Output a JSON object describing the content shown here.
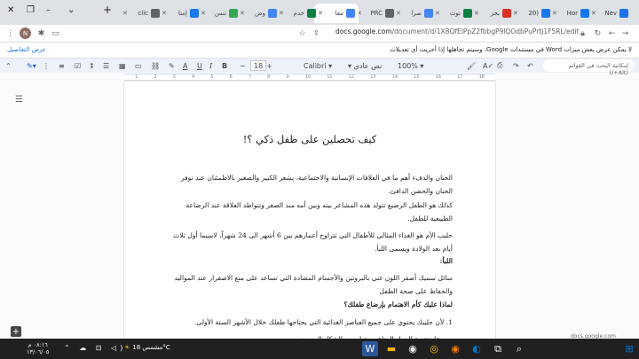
{
  "browser": {
    "tabs": [
      {
        "label": "Nev",
        "color": "#1a73e8"
      },
      {
        "label": "Hor",
        "color": "#1877f2"
      },
      {
        "label": "(20",
        "color": "#1877f2"
      },
      {
        "label": "بحر",
        "color": "#d93025"
      },
      {
        "label": "توث",
        "color": "#0b8043"
      },
      {
        "label": "صرا",
        "color": "#4285f4"
      },
      {
        "label": "PRC",
        "color": "#5f6368"
      },
      {
        "label": "مقا",
        "color": "#4285f4"
      },
      {
        "label": "خدم",
        "color": "#0b8043"
      },
      {
        "label": "وض",
        "color": "#4285f4"
      },
      {
        "label": "تنس",
        "color": "#34a853"
      },
      {
        "label": "إمتا",
        "color": "#1877f2"
      },
      {
        "label": "clic",
        "color": "#5f6368"
      }
    ],
    "url_domain": "docs.google.com",
    "url_path": "/document/d/1X8QfEIPpZ2fbbgP9lQOdbPuPrtj1F5RL/edit",
    "avatar_letter": "N"
  },
  "notice": {
    "text": "لا يمكن عرض بعض ميزات Word في مستندات Google، وسيتم تجاهلها إذا أجريت أي تعديلات",
    "link": "عرض التفاصيل"
  },
  "toolbar": {
    "search_placeholder": "إمكانية البحث في القوائم (Alt+/)",
    "zoom": "100%",
    "style": "نص عادي",
    "font": "Calibri",
    "font_size": "18"
  },
  "document": {
    "title": "كيف تحصلين على طفل ذكي ؟!",
    "paragraphs": [
      {
        "text": "الحنان والدفء أهم ما في العلاقات الإنسانية والاجتماعية، يشعر الكبير والصغير بالاطمئنان عند توفر الحنان والحضن الدافئ.",
        "bold": false
      },
      {
        "text": "كذلك هو الطفل الرضيع تتولد هذه المشاعر بينه وبين أمه منذ الصغر وتتواطد العلاقة عند الرضاعة الطبيعية للطفل.",
        "bold": false
      },
      {
        "text": "حليب الأم هو الغذاء المثالي للأطفال التي تتراوح أعمارهم بين 6 أشهر الى 24 شهراً، لاسيما أول ثلاث أيام بعد الولادة ويسمى اللبأ.",
        "bold": false
      },
      {
        "text": "اللبأ:",
        "bold": true
      },
      {
        "text": "سائل سميك أصفر اللون غني بالبروتين والأجسام المضادة التي تساعد على منع الاصفرار عند المواليد والحفاظ على صحة الطفل",
        "bold": false
      },
      {
        "text": "لماذا عليك كأم الاهتمام بإرضاع طفلك؟",
        "bold": true
      },
      {
        "text": "1. لأن حليبك يحتوي على جميع العناصر الغذائية التي يحتاجها طفلك خلال الأشهر الستة الأولى.",
        "bold": false
      },
      {
        "text": "عل تقوية الجهاز المناعي وتطويره بالشكل الصحيح.",
        "bold": false
      }
    ]
  },
  "taskbar": {
    "weather": "مشمس 18°C",
    "time": "٠٨:١٦ م",
    "date": "١٣/٠٦/٠٥"
  }
}
